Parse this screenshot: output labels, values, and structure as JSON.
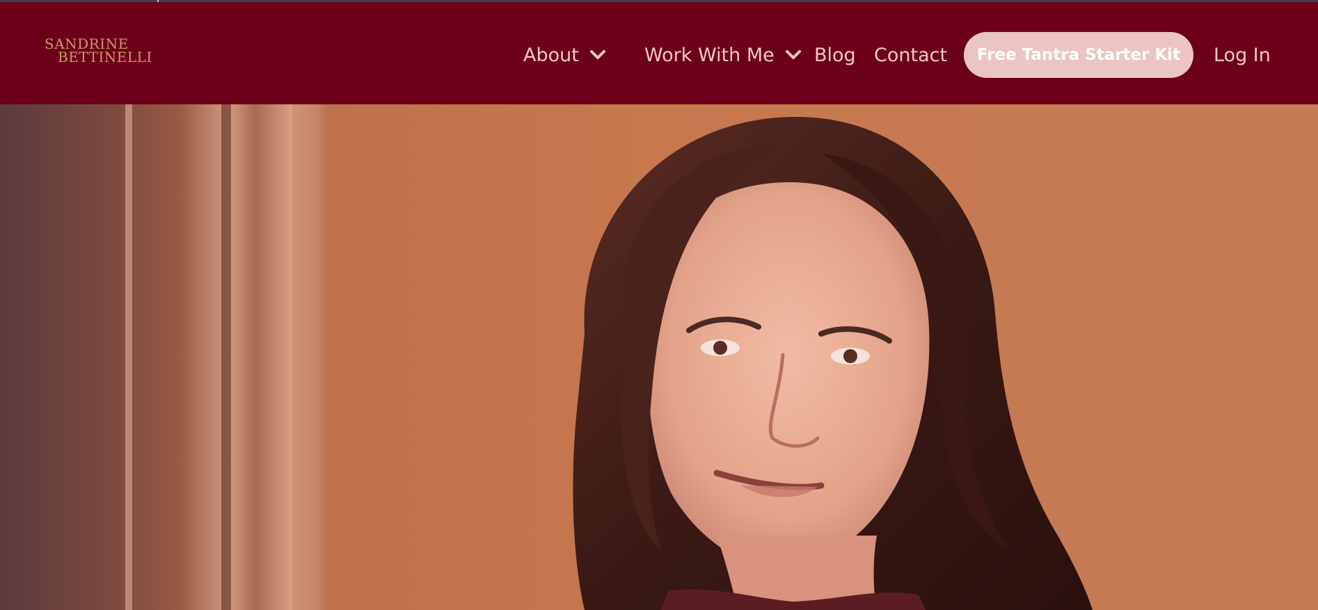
{
  "brand": {
    "logo_line1": "SANDRINE",
    "logo_line2": "BETTINELLI",
    "colors": {
      "header_bg": "#6d0019",
      "nav_text": "#f0c7c7",
      "cta_bg": "#ebc5c3",
      "cta_text": "#ffffff",
      "logo": "#c79a6b"
    }
  },
  "nav": {
    "about": "About",
    "work_with_me": "Work With Me",
    "blog": "Blog",
    "contact": "Contact",
    "cta": "Free Tantra Starter Kit",
    "login": "Log In",
    "dropdown_icon": "chevron-down-icon"
  }
}
